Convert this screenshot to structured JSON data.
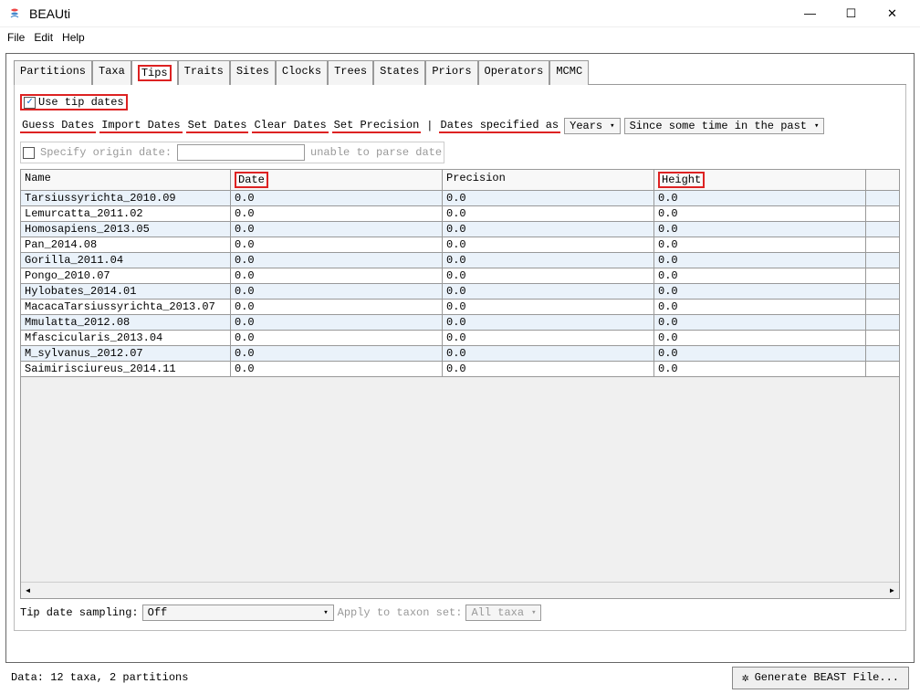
{
  "window": {
    "title": "BEAUti"
  },
  "menubar": {
    "items": [
      "File",
      "Edit",
      "Help"
    ]
  },
  "tabs": {
    "items": [
      "Partitions",
      "Taxa",
      "Tips",
      "Traits",
      "Sites",
      "Clocks",
      "Trees",
      "States",
      "Priors",
      "Operators",
      "MCMC"
    ],
    "active": "Tips"
  },
  "tips": {
    "use_tip_dates_label": "Use tip dates",
    "use_tip_dates_checked": true,
    "buttons": [
      "Guess Dates",
      "Import Dates",
      "Set Dates",
      "Clear Dates",
      "Set Precision"
    ],
    "dates_specified_label": "Dates specified as",
    "units_select": "Years",
    "direction_select": "Since some time in the past",
    "specify_origin_label": "Specify origin date:",
    "specify_origin_checked": false,
    "origin_hint": "unable to parse date",
    "tip_date_sampling_label": "Tip date sampling:",
    "tip_date_sampling_value": "Off",
    "apply_to_taxon_label": "Apply to taxon set:",
    "apply_to_taxon_value": "All taxa"
  },
  "table": {
    "columns": [
      "Name",
      "Date",
      "Precision",
      "Height"
    ],
    "rows": [
      {
        "name": "Tarsiussyrichta_2010.09",
        "date": "0.0",
        "precision": "0.0",
        "height": "0.0"
      },
      {
        "name": "Lemurcatta_2011.02",
        "date": "0.0",
        "precision": "0.0",
        "height": "0.0"
      },
      {
        "name": "Homosapiens_2013.05",
        "date": "0.0",
        "precision": "0.0",
        "height": "0.0"
      },
      {
        "name": "Pan_2014.08",
        "date": "0.0",
        "precision": "0.0",
        "height": "0.0"
      },
      {
        "name": "Gorilla_2011.04",
        "date": "0.0",
        "precision": "0.0",
        "height": "0.0"
      },
      {
        "name": "Pongo_2010.07",
        "date": "0.0",
        "precision": "0.0",
        "height": "0.0"
      },
      {
        "name": "Hylobates_2014.01",
        "date": "0.0",
        "precision": "0.0",
        "height": "0.0"
      },
      {
        "name": "MacacaTarsiussyrichta_2013.07",
        "date": "0.0",
        "precision": "0.0",
        "height": "0.0"
      },
      {
        "name": "Mmulatta_2012.08",
        "date": "0.0",
        "precision": "0.0",
        "height": "0.0"
      },
      {
        "name": "Mfascicularis_2013.04",
        "date": "0.0",
        "precision": "0.0",
        "height": "0.0"
      },
      {
        "name": "M_sylvanus_2012.07",
        "date": "0.0",
        "precision": "0.0",
        "height": "0.0"
      },
      {
        "name": "Saimirisciureus_2014.11",
        "date": "0.0",
        "precision": "0.0",
        "height": "0.0"
      }
    ]
  },
  "status": {
    "text": "Data: 12 taxa, 2 partitions",
    "generate_label": "Generate BEAST File..."
  }
}
